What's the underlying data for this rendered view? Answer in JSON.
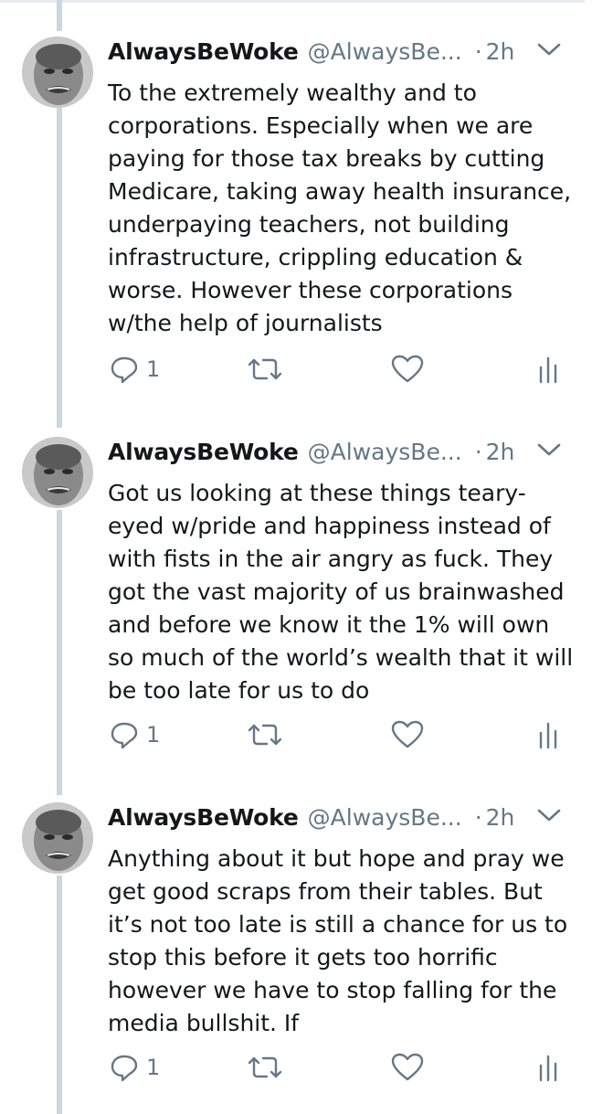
{
  "tweets": [
    {
      "author_name": "AlwaysBeWoke",
      "handle": "@AlwaysBe...",
      "separator": "·",
      "time": "2h",
      "text": "To the extremely wealthy and to\ncorporations. Especially when we are\npaying for those tax breaks by cutting\nMedicare, taking away health insurance,\nunderpaying teachers, not building\ninfrastructure, crippling education &\nworse. However these corporations\nw/the help of journalists",
      "reply_count": "1"
    },
    {
      "author_name": "AlwaysBeWoke",
      "handle": "@AlwaysBe...",
      "separator": "·",
      "time": "2h",
      "text": "Got us looking at these things teary-\neyed w/pride and happiness instead of\nwith fists in the air angry as fuck. They\ngot the vast majority of us brainwashed\nand before we know it the 1% will own\nso much of the world’s wealth that it will\nbe too late for us to do",
      "reply_count": "1"
    },
    {
      "author_name": "AlwaysBeWoke",
      "handle": "@AlwaysBe...",
      "separator": "·",
      "time": "2h",
      "text": "Anything about it but hope and pray we\nget good scraps from their tables. But\nit’s not too late is still a chance for us to\nstop this before it gets too horrific\nhowever we have to stop falling for the\nmedia bullshit. If",
      "reply_count": "1"
    }
  ],
  "icons": {
    "reply": "reply-icon",
    "retweet": "retweet-icon",
    "like": "heart-icon",
    "analytics": "analytics-icon",
    "caret": "chevron-down-icon"
  },
  "colors": {
    "text": "#14171a",
    "secondary": "#657786",
    "thread_line": "#ccd6dd"
  }
}
